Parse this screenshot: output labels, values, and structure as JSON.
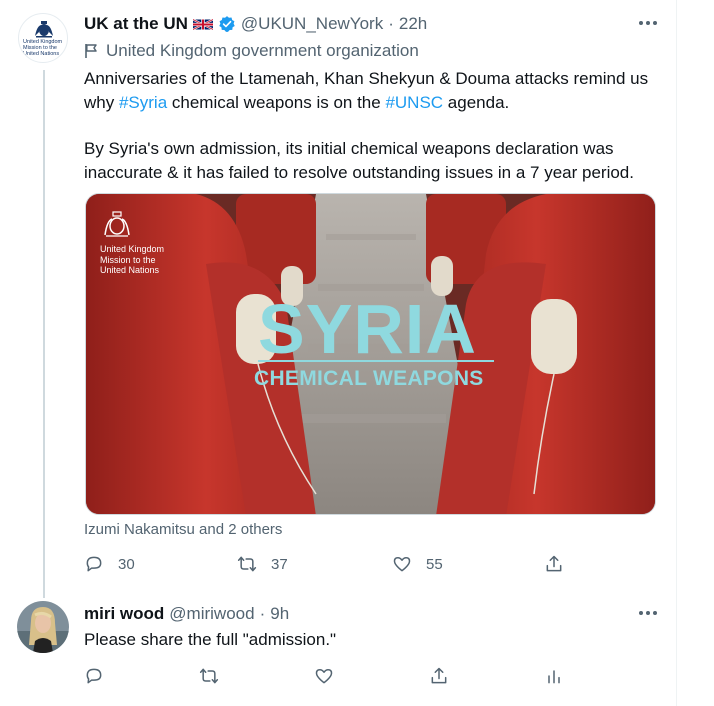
{
  "tweet": {
    "display_name": "UK at the UN",
    "handle": "@UKUN_NewYork",
    "separator": "·",
    "time": "22h",
    "avatar_text": "United Kingdom\nMission to the\nUnited Nations",
    "gov_label": "United Kingdom government organization",
    "text_p1_a": "Anniversaries of the Ltamenah, Khan Shekyun & Douma attacks remind us why ",
    "text_p1_tag1": "#Syria",
    "text_p1_b": " chemical weapons is on the ",
    "text_p1_tag2": "#UNSC",
    "text_p1_c": " agenda.",
    "text_p2": "By Syria's own admission, its initial chemical weapons declaration was inaccurate & it has failed to resolve outstanding issues in a 7 year period.",
    "media": {
      "brand_text": "United Kingdom\nMission to the\nUnited Nations",
      "headline": "SYRIA",
      "subheadline": "CHEMICAL WEAPONS",
      "accent_color": "#8fd9df",
      "seat_color": "#c7362c"
    },
    "tagged": "Izumi Nakamitsu and 2 others",
    "actions": {
      "reply_count": "30",
      "retweet_count": "37",
      "like_count": "55"
    }
  },
  "reply": {
    "display_name": "miri wood",
    "handle": "@miriwood",
    "separator": "·",
    "time": "9h",
    "text": "Please share the full \"admission.\""
  },
  "colors": {
    "link": "#1d9bf0",
    "secondary_text": "#536471",
    "verified": "#1d9bf0"
  },
  "icons": [
    "reply-icon",
    "retweet-icon",
    "like-icon",
    "share-icon",
    "analytics-icon",
    "more-icon",
    "verified-icon",
    "uk-flag-icon",
    "government-flag-icon"
  ]
}
